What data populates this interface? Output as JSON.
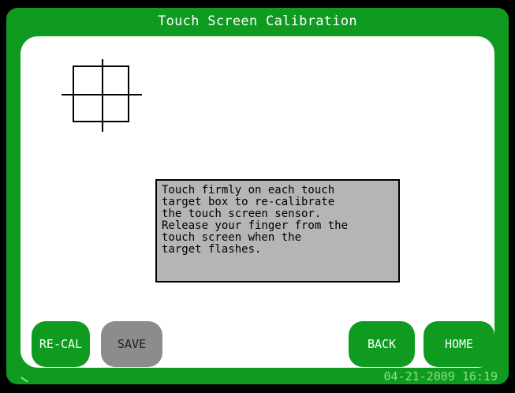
{
  "header": {
    "title": "Touch Screen Calibration"
  },
  "message": {
    "text": "Touch firmly on each touch\ntarget box to re-calibrate\nthe touch screen sensor.\nRelease your finger from the\ntouch screen when the\ntarget flashes."
  },
  "buttons": {
    "recal": "RE-CAL",
    "save": "SAVE",
    "back": "BACK",
    "home": "HOME"
  },
  "status": {
    "datetime": "04-21-2009 16:19"
  },
  "icons": {
    "calibration_target": "crosshair-icon"
  },
  "colors": {
    "accent_green": "#0e9b1f",
    "status_text": "#8be08b",
    "message_bg": "#b5b5b5",
    "save_button": "#8c8c8c"
  }
}
